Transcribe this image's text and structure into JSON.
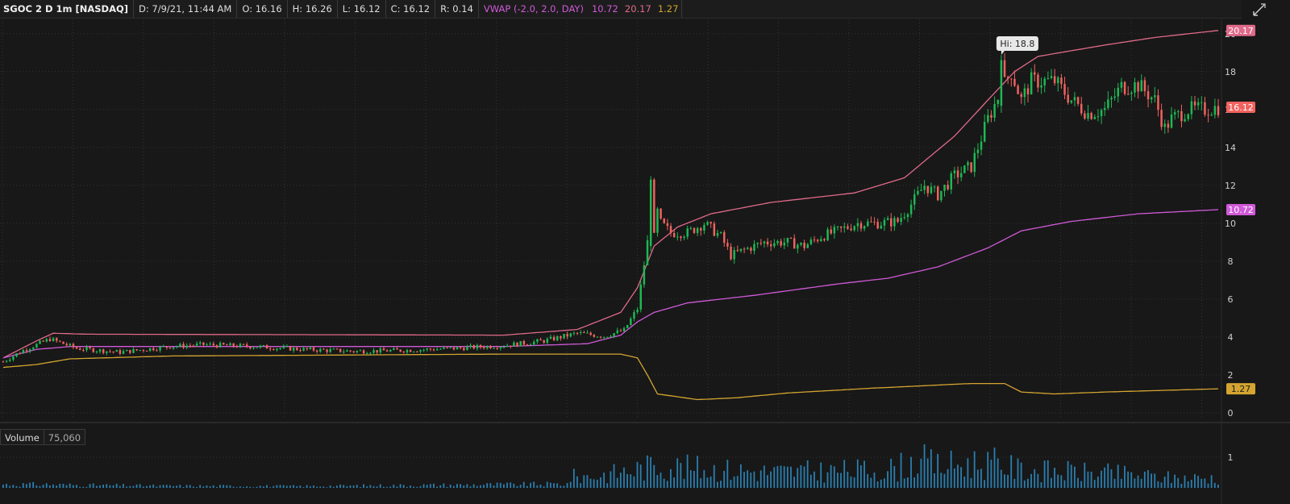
{
  "header": {
    "symbol": "SGOC 2 D 1m [NASDAQ]",
    "date": "D: 7/9/21, 11:44 AM",
    "open": "O: 16.16",
    "high": "H: 16.26",
    "low": "L: 16.12",
    "close": "C: 16.12",
    "range": "R: 0.14",
    "vwap_label": "VWAP (-2.0, 2.0, DAY)",
    "vwap_value": "10.72",
    "upper_value": "20.17",
    "lower_value": "1.27"
  },
  "volume_header": {
    "label": "Volume",
    "value": "75,060"
  },
  "colors": {
    "up": "#1db954",
    "down": "#f0625f",
    "vwap": "#d05ad8",
    "upper": "#e06a8a",
    "lower": "#d4a530",
    "volume": "#2a7fb0"
  },
  "chart_data": {
    "type": "candlestick",
    "ylim": [
      0,
      20.5
    ],
    "y_ticks": [
      "0",
      "2",
      "4",
      "6",
      "8",
      "10",
      "12",
      "14",
      "16",
      "18",
      "20"
    ],
    "volume_ticks": [
      "1"
    ],
    "high_annotation": "Hi: 18.8",
    "price_labels": [
      {
        "name": "upper",
        "value": 20.17,
        "text": "20.17"
      },
      {
        "name": "close",
        "value": 16.12,
        "text": "16.12"
      },
      {
        "name": "vwap",
        "value": 10.72,
        "text": "10.72"
      },
      {
        "name": "lower",
        "value": 1.27,
        "text": "1.27"
      }
    ],
    "price_anchors": [
      [
        0,
        2.7
      ],
      [
        6,
        3.3
      ],
      [
        14,
        3.9
      ],
      [
        22,
        3.4
      ],
      [
        35,
        3.2
      ],
      [
        50,
        3.5
      ],
      [
        60,
        3.6
      ],
      [
        75,
        3.5
      ],
      [
        90,
        3.35
      ],
      [
        105,
        3.25
      ],
      [
        120,
        3.3
      ],
      [
        135,
        3.4
      ],
      [
        150,
        3.55
      ],
      [
        162,
        3.8
      ],
      [
        172,
        4.2
      ],
      [
        180,
        4.05
      ],
      [
        186,
        4.35
      ],
      [
        190,
        5.5
      ],
      [
        193,
        9
      ],
      [
        195,
        11.2
      ],
      [
        197,
        10
      ],
      [
        200,
        9.5
      ],
      [
        205,
        9.5
      ],
      [
        210,
        10
      ],
      [
        215,
        9.3
      ],
      [
        218,
        8.3
      ],
      [
        222,
        8.6
      ],
      [
        228,
        9
      ],
      [
        235,
        9
      ],
      [
        240,
        8.8
      ],
      [
        245,
        9.3
      ],
      [
        250,
        9.6
      ],
      [
        256,
        10
      ],
      [
        262,
        10
      ],
      [
        268,
        10.1
      ],
      [
        272,
        11
      ],
      [
        276,
        12
      ],
      [
        280,
        11.5
      ],
      [
        285,
        12.5
      ],
      [
        290,
        13
      ],
      [
        295,
        15.5
      ],
      [
        299,
        17
      ],
      [
        302,
        18
      ],
      [
        305,
        16.5
      ],
      [
        308,
        17.5
      ],
      [
        315,
        17.5
      ],
      [
        320,
        16.5
      ],
      [
        325,
        15.8
      ],
      [
        330,
        16
      ],
      [
        335,
        17.2
      ],
      [
        340,
        17.3
      ],
      [
        345,
        16.5
      ],
      [
        348,
        15
      ],
      [
        350,
        15.5
      ],
      [
        355,
        16
      ],
      [
        360,
        16
      ],
      [
        364,
        16.12
      ]
    ],
    "vwap_anchors": [
      [
        0,
        2.9
      ],
      [
        10,
        3.35
      ],
      [
        20,
        3.5
      ],
      [
        150,
        3.5
      ],
      [
        175,
        3.65
      ],
      [
        185,
        4.1
      ],
      [
        190,
        4.8
      ],
      [
        195,
        5.3
      ],
      [
        205,
        5.8
      ],
      [
        225,
        6.2
      ],
      [
        250,
        6.8
      ],
      [
        265,
        7.1
      ],
      [
        280,
        7.7
      ],
      [
        295,
        8.7
      ],
      [
        305,
        9.6
      ],
      [
        320,
        10.1
      ],
      [
        340,
        10.5
      ],
      [
        364,
        10.72
      ]
    ],
    "upper_anchors": [
      [
        0,
        2.9
      ],
      [
        10,
        3.8
      ],
      [
        15,
        4.2
      ],
      [
        25,
        4.15
      ],
      [
        150,
        4.1
      ],
      [
        172,
        4.4
      ],
      [
        185,
        5.3
      ],
      [
        190,
        6.6
      ],
      [
        195,
        8.8
      ],
      [
        202,
        9.8
      ],
      [
        212,
        10.5
      ],
      [
        230,
        11.1
      ],
      [
        255,
        11.6
      ],
      [
        270,
        12.4
      ],
      [
        285,
        14.6
      ],
      [
        295,
        16.5
      ],
      [
        303,
        18
      ],
      [
        310,
        18.8
      ],
      [
        330,
        19.4
      ],
      [
        345,
        19.8
      ],
      [
        364,
        20.17
      ]
    ],
    "lower_anchors": [
      [
        0,
        2.4
      ],
      [
        10,
        2.55
      ],
      [
        20,
        2.85
      ],
      [
        50,
        3.0
      ],
      [
        150,
        3.1
      ],
      [
        185,
        3.1
      ],
      [
        190,
        2.9
      ],
      [
        193,
        2.0
      ],
      [
        196,
        1.0
      ],
      [
        208,
        0.7
      ],
      [
        220,
        0.8
      ],
      [
        235,
        1.05
      ],
      [
        260,
        1.3
      ],
      [
        290,
        1.55
      ],
      [
        300,
        1.55
      ],
      [
        305,
        1.1
      ],
      [
        315,
        1.0
      ],
      [
        330,
        1.1
      ],
      [
        364,
        1.27
      ]
    ],
    "volume_spikes": [
      [
        15,
        0.45
      ],
      [
        45,
        0.3
      ],
      [
        90,
        0.25
      ],
      [
        178,
        0.6
      ],
      [
        192,
        1.0
      ],
      [
        196,
        1.15
      ],
      [
        205,
        1.0
      ],
      [
        230,
        0.8
      ],
      [
        265,
        0.9
      ],
      [
        275,
        1.35
      ],
      [
        280,
        1.1
      ],
      [
        293,
        1.25
      ],
      [
        298,
        1.2
      ],
      [
        305,
        0.9
      ],
      [
        320,
        0.8
      ],
      [
        335,
        0.7
      ],
      [
        350,
        0.5
      ]
    ]
  }
}
